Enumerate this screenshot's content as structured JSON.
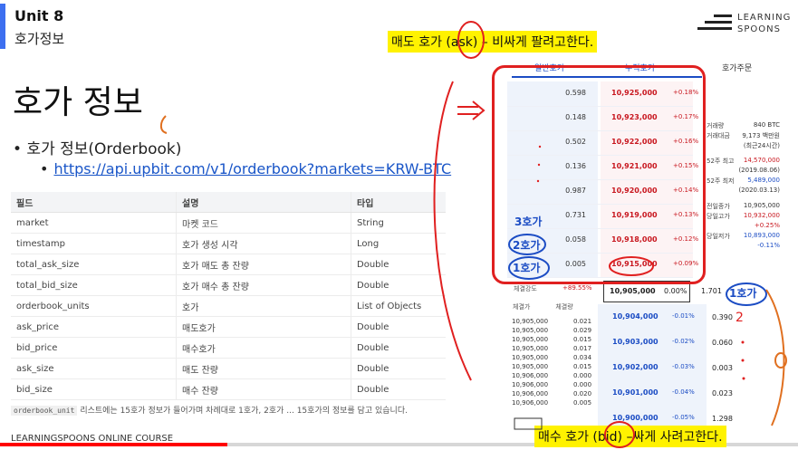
{
  "header": {
    "unit": "Unit 8",
    "subtitle": "호가정보"
  },
  "logo": {
    "line1": "LEARNING",
    "line2": "SPOONS"
  },
  "slide": {
    "title": "호가 정보",
    "bullet": "• 호가 정보(Orderbook)",
    "link": "https://api.upbit.com/v1/orderbook?markets=KRW-BTC"
  },
  "table": {
    "headers": [
      "필드",
      "설명",
      "타입"
    ],
    "rows": [
      [
        "market",
        "마켓 코드",
        "String"
      ],
      [
        "timestamp",
        "호가 생성 시각",
        "Long"
      ],
      [
        "total_ask_size",
        "호가 매도 총 잔량",
        "Double"
      ],
      [
        "total_bid_size",
        "호가 매수 총 잔량",
        "Double"
      ],
      [
        "orderbook_units",
        "호가",
        "List of Objects"
      ],
      [
        "ask_price",
        "매도호가",
        "Double"
      ],
      [
        "bid_price",
        "매수호가",
        "Double"
      ],
      [
        "ask_size",
        "매도 잔량",
        "Double"
      ],
      [
        "bid_size",
        "매수 잔량",
        "Double"
      ]
    ]
  },
  "footnote": {
    "code": "orderbook_unit",
    "text": "리스트에는 15호가 정보가 들어가며 차례대로 1호가, 2호가 ... 15호가의 정보를 담고 있습니다."
  },
  "footer": "LEARNINGSPOONS ONLINE COURSE",
  "progress": 0.285,
  "annotations": {
    "ask": "매도 호가 (ask) – 비싸게 팔려고한다.",
    "bid": "매수 호가 (bid) –싸게 사려고한다.",
    "labels": [
      "3호가",
      "2호가",
      "1호가",
      "1호가",
      "2"
    ]
  },
  "orderbook": {
    "tabs": [
      "일반호가",
      "누적호가",
      "호가주문"
    ],
    "asks": [
      {
        "qty": "0.598",
        "price": "10,925,000",
        "chg": "+0.18%"
      },
      {
        "qty": "0.148",
        "price": "10,923,000",
        "chg": "+0.17%"
      },
      {
        "qty": "0.502",
        "price": "10,922,000",
        "chg": "+0.16%"
      },
      {
        "qty": "0.136",
        "price": "10,921,000",
        "chg": "+0.15%"
      },
      {
        "qty": "0.987",
        "price": "10,920,000",
        "chg": "+0.14%"
      },
      {
        "qty": "0.731",
        "price": "10,919,000",
        "chg": "+0.13%"
      },
      {
        "qty": "0.058",
        "price": "10,918,000",
        "chg": "+0.12%"
      },
      {
        "qty": "0.005",
        "price": "10,915,000",
        "chg": "+0.09%"
      }
    ],
    "current": {
      "label": "체결강도",
      "rate": "+89.55%",
      "price": "10,905,000",
      "chg": "0.00%",
      "qty": "1.701"
    },
    "side": [
      {
        "label": "거래량",
        "val": "840 BTC",
        "color": "#333333"
      },
      {
        "label": "거래대금",
        "val": "9,173 백만원",
        "color": "#333333"
      },
      {
        "label": "",
        "val": "(최근24시간)",
        "color": "#333333"
      },
      {
        "label": "52주 최고",
        "val": "14,570,000",
        "color": "#c8171f"
      },
      {
        "label": "",
        "val": "(2019.08.06)",
        "color": "#333333"
      },
      {
        "label": "52주 최저",
        "val": "5,489,000",
        "color": "#1b4cc4"
      },
      {
        "label": "",
        "val": "(2020.03.13)",
        "color": "#333333"
      },
      {
        "label": "전일종가",
        "val": "10,905,000",
        "color": "#333333"
      },
      {
        "label": "당일고가",
        "val": "10,932,000",
        "color": "#c8171f"
      },
      {
        "label": "",
        "val": "+0.25%",
        "color": "#c8171f"
      },
      {
        "label": "당일저가",
        "val": "10,893,000",
        "color": "#1b4cc4"
      },
      {
        "label": "",
        "val": "-0.11%",
        "color": "#1b4cc4"
      }
    ],
    "trade_head": [
      "체결가",
      "체결량"
    ],
    "trades": [
      [
        "10,905,000",
        "0.021"
      ],
      [
        "10,905,000",
        "0.029"
      ],
      [
        "10,905,000",
        "0.015"
      ],
      [
        "10,905,000",
        "0.017"
      ],
      [
        "10,905,000",
        "0.034"
      ],
      [
        "10,905,000",
        "0.015"
      ],
      [
        "10,906,000",
        "0.000"
      ],
      [
        "10,906,000",
        "0.000"
      ],
      [
        "10,906,000",
        "0.020"
      ],
      [
        "10,906,000",
        "0.005"
      ]
    ],
    "bids": [
      {
        "price": "10,904,000",
        "chg": "-0.01%",
        "qty": "0.390"
      },
      {
        "price": "10,903,000",
        "chg": "-0.02%",
        "qty": "0.060"
      },
      {
        "price": "10,902,000",
        "chg": "-0.03%",
        "qty": "0.003"
      },
      {
        "price": "10,901,000",
        "chg": "-0.04%",
        "qty": "0.023"
      },
      {
        "price": "10,900,000",
        "chg": "-0.05%",
        "qty": "1.298"
      }
    ]
  }
}
